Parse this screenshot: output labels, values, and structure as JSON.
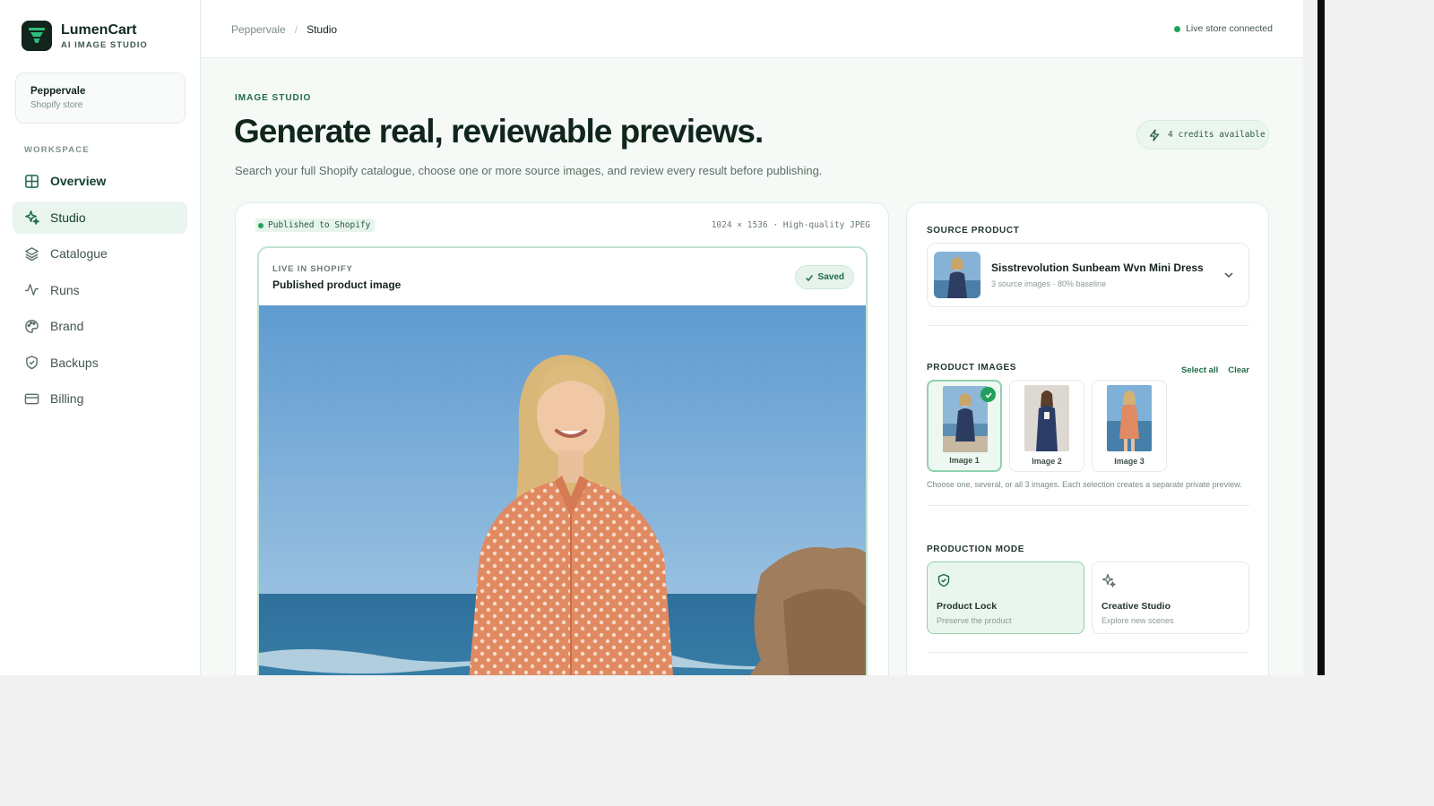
{
  "brand": {
    "name": "LumenCart",
    "subtitle": "AI IMAGE STUDIO"
  },
  "store": {
    "name": "Peppervale",
    "type": "Shopify store"
  },
  "sidebar": {
    "section_label": "WORKSPACE",
    "items": [
      {
        "label": "Overview",
        "icon": "grid-icon"
      },
      {
        "label": "Studio",
        "icon": "sparkles-icon"
      },
      {
        "label": "Catalogue",
        "icon": "layers-icon"
      },
      {
        "label": "Runs",
        "icon": "activity-icon"
      },
      {
        "label": "Brand",
        "icon": "palette-icon"
      },
      {
        "label": "Backups",
        "icon": "shield-icon"
      },
      {
        "label": "Billing",
        "icon": "credit-card-icon"
      }
    ]
  },
  "topbar": {
    "breadcrumb": [
      "Peppervale",
      "Studio"
    ],
    "status": "Live store connected"
  },
  "header": {
    "eyebrow": "IMAGE STUDIO",
    "title": "Generate real, reviewable previews.",
    "subtitle": "Search your full Shopify catalogue, choose one or more source images, and review every result before publishing.",
    "credits": "4 credits available"
  },
  "preview": {
    "status_tag": "Published to Shopify",
    "meta": "1024 × 1536 · High-quality JPEG",
    "frame_eyebrow": "LIVE IN SHOPIFY",
    "frame_title": "Published product image",
    "saved_label": "Saved"
  },
  "panel": {
    "source_label": "SOURCE PRODUCT",
    "product": {
      "name": "Sisstrevolution Sunbeam Wvn Mini Dress",
      "meta": "3 source images · 80% baseline"
    },
    "images_label": "PRODUCT IMAGES",
    "select_all": "Select all",
    "clear": "Clear",
    "images": [
      {
        "label": "Image 1",
        "selected": true
      },
      {
        "label": "Image 2",
        "selected": false
      },
      {
        "label": "Image 3",
        "selected": false
      }
    ],
    "hint": "Choose one, several, or all 3 images. Each selection creates a separate private preview.",
    "mode_label": "PRODUCTION MODE",
    "modes": [
      {
        "title": "Product Lock",
        "desc": "Preserve the product",
        "icon": "shield-check-icon",
        "selected": true
      },
      {
        "title": "Creative Studio",
        "desc": "Explore new scenes",
        "icon": "sparkles-icon",
        "selected": false
      }
    ]
  },
  "colors": {
    "accent": "#1f6a47",
    "accent_light": "#e9f5ee",
    "live_dot": "#22a05b",
    "logo_bg": "#12241c"
  }
}
